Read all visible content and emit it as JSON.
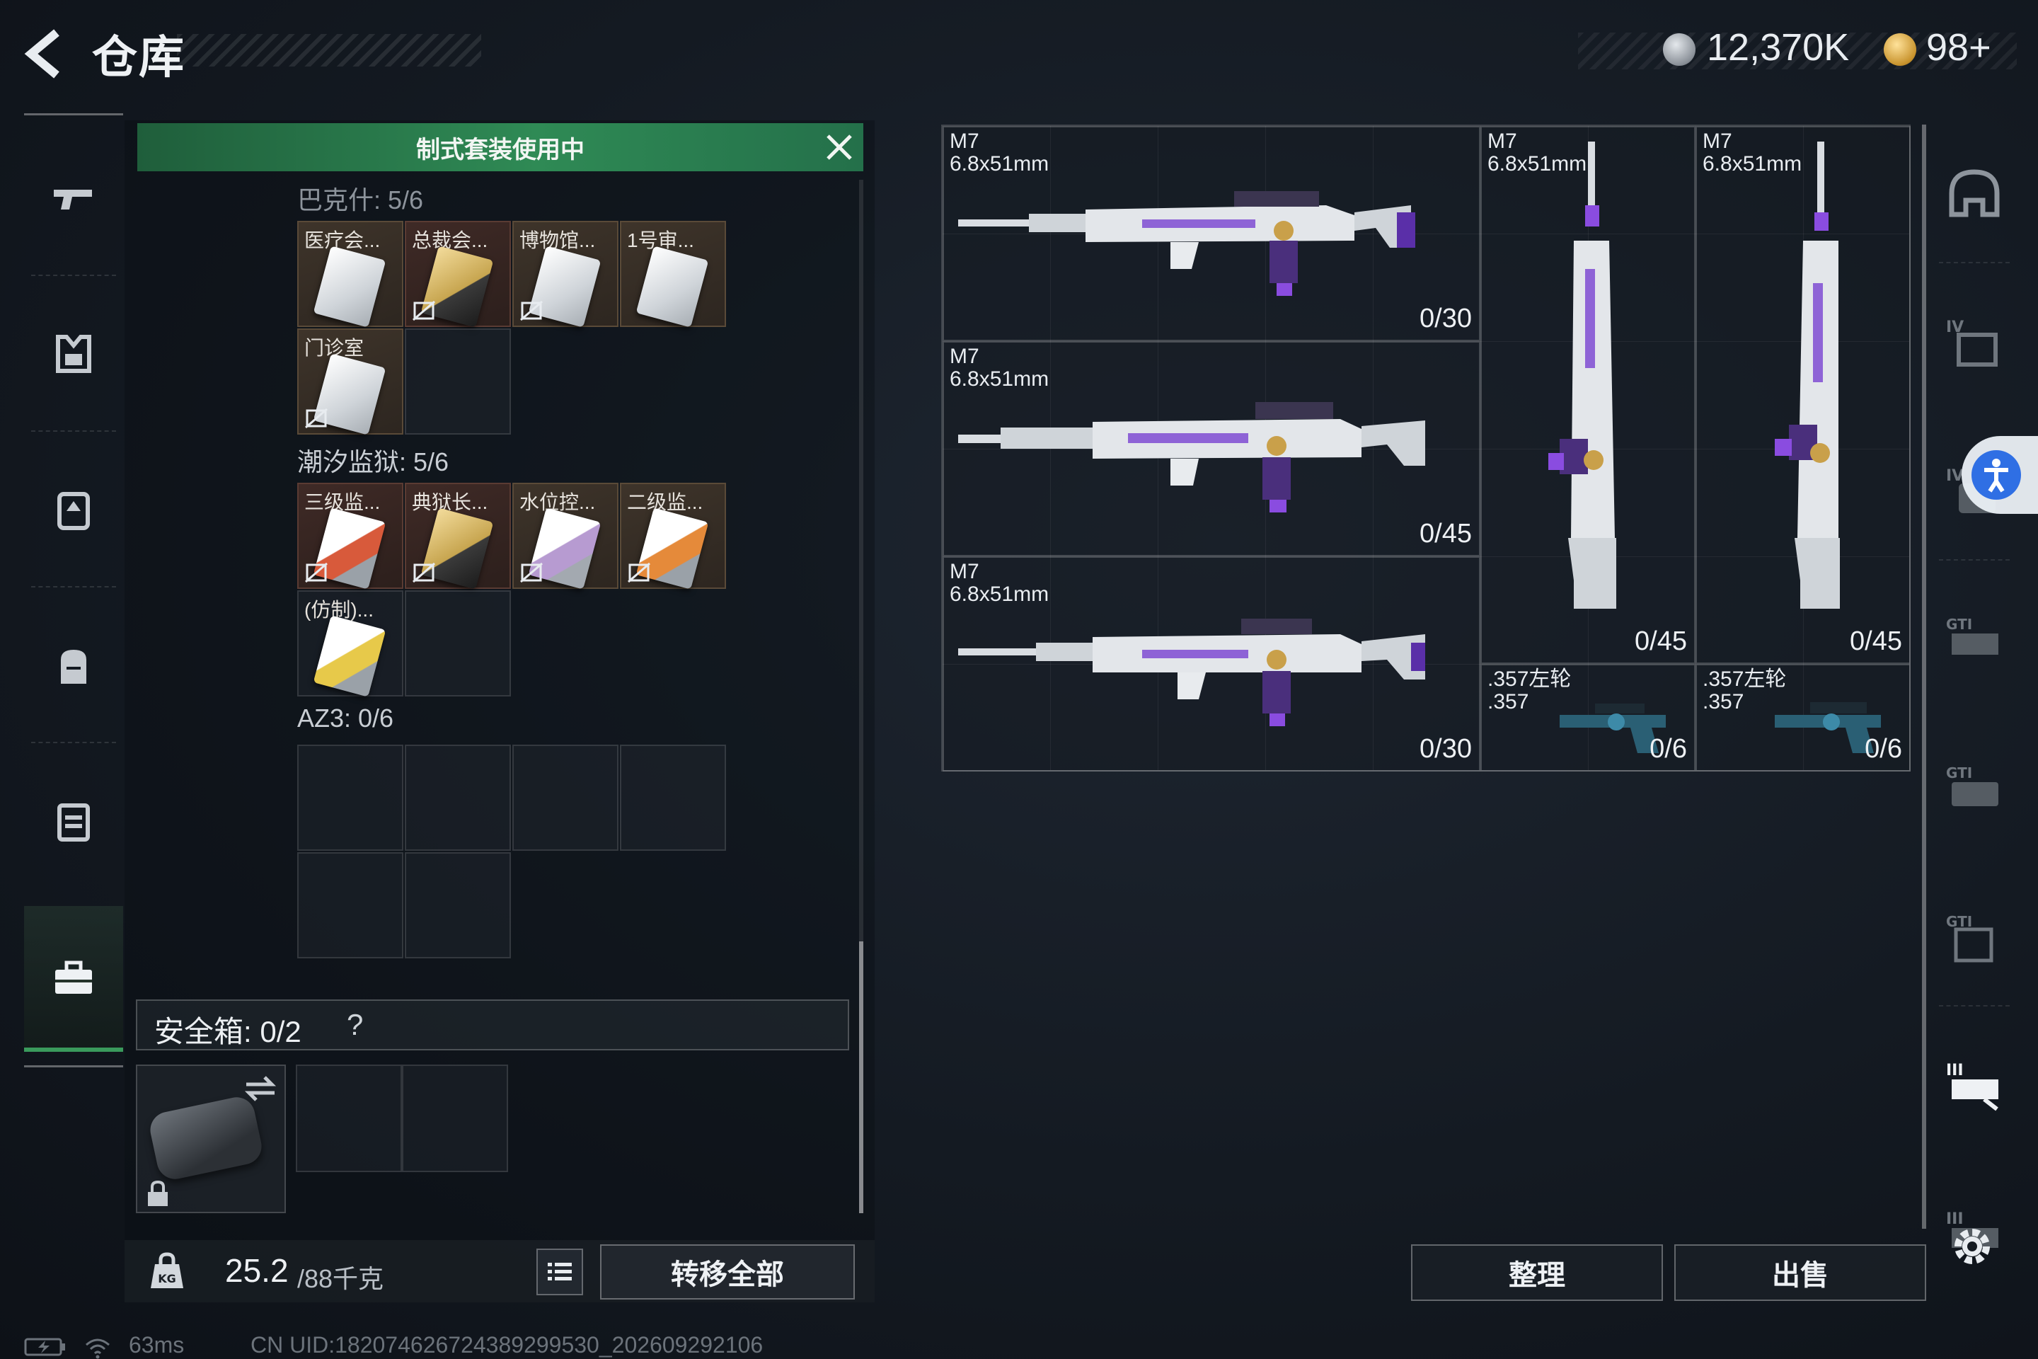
{
  "header": {
    "title": "仓库",
    "silver_currency": "12,370K",
    "gold_currency": "98+"
  },
  "left_nav": {
    "items": [
      "pistol-icon",
      "armor-icon",
      "chest-rig-icon",
      "backpack-icon",
      "case-icon",
      "toolbox-icon"
    ],
    "active": "toolbox-icon"
  },
  "kit_banner": {
    "label": "制式套装使用中"
  },
  "sections": [
    {
      "label": "巴克什: 5/6",
      "cards": [
        {
          "name": "医疗会...",
          "style": "brown",
          "color": "white",
          "noshare": false
        },
        {
          "name": "总裁会...",
          "style": "red",
          "color": "gold",
          "noshare": true
        },
        {
          "name": "博物馆...",
          "style": "brown",
          "color": "white",
          "noshare": true
        },
        {
          "name": "1号审...",
          "style": "brown",
          "color": "white",
          "noshare": false
        },
        {
          "name": "门诊室",
          "style": "brown",
          "color": "white",
          "noshare": true
        }
      ]
    },
    {
      "label": "潮汐监狱: 5/6",
      "cards": [
        {
          "name": "三级监...",
          "style": "red",
          "color": "red",
          "noshare": true
        },
        {
          "name": "典狱长...",
          "style": "red",
          "color": "gold",
          "noshare": true
        },
        {
          "name": "水位控...",
          "style": "brown",
          "color": "purple",
          "noshare": true
        },
        {
          "name": "二级监...",
          "style": "brown",
          "color": "orange",
          "noshare": true
        },
        {
          "name": "(仿制)...",
          "style": "plain",
          "color": "yellow",
          "noshare": false
        }
      ]
    },
    {
      "label": "AZ3: 0/6",
      "cards": []
    }
  ],
  "safe_box": {
    "label": "安全箱: 0/2",
    "help": "?"
  },
  "weight": {
    "current": "25.2",
    "max": "/88千克"
  },
  "buttons": {
    "transfer_all": "转移全部",
    "sort": "整理",
    "sell": "出售"
  },
  "weapons": [
    {
      "name": "M7\n6.8x51mm",
      "ammo": "0/30"
    },
    {
      "name": "M7\n6.8x51mm",
      "ammo": "0/45"
    },
    {
      "name": "M7\n6.8x51mm",
      "ammo": "0/30"
    },
    {
      "name": "M7\n6.8x51mm",
      "ammo": "0/45"
    },
    {
      "name": "M7\n6.8x51mm",
      "ammo": "0/45"
    },
    {
      "name": ".357左轮\n.357",
      "ammo": "0/6"
    },
    {
      "name": ".357左轮\n.357",
      "ammo": "0/6"
    }
  ],
  "right_nav": {
    "items": [
      "helmet-icon",
      "armor-tier4-icon",
      "armor-tier4b-icon",
      "rig-gti-icon",
      "rig-gti-b-icon",
      "rig-gti-c-icon",
      "rig-tier3-icon",
      "rig-tier3b-icon"
    ],
    "active": "rig-tier3-icon"
  },
  "status": {
    "ping": "63ms",
    "uid": "CN UID:182074626724389299530_202609292106"
  },
  "colors": {
    "accent_green": "#2f8a55",
    "access_blue": "#2f6fe4"
  }
}
